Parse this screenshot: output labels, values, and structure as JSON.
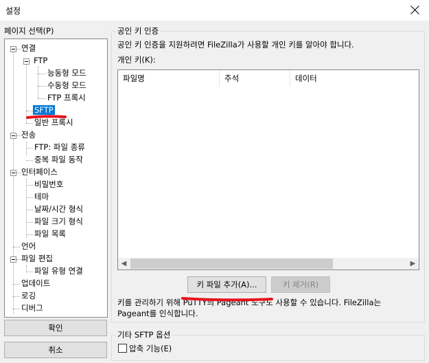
{
  "window": {
    "title": "설정"
  },
  "page_select_label": "페이지 선택(P)",
  "tree": [
    {
      "label": "연결"
    },
    {
      "label": "FTP"
    },
    {
      "label": "능동형 모드"
    },
    {
      "label": "수동형 모드"
    },
    {
      "label": "FTP 프록시"
    },
    {
      "label": "SFTP",
      "selected": true
    },
    {
      "label": "일반 프록시"
    },
    {
      "label": "전송"
    },
    {
      "label": "FTP: 파일 종류"
    },
    {
      "label": "중복 파일 동작"
    },
    {
      "label": "인터페이스"
    },
    {
      "label": "비밀번호"
    },
    {
      "label": "테마"
    },
    {
      "label": "날짜/시간 형식"
    },
    {
      "label": "파일 크기 형식"
    },
    {
      "label": "파일 목록"
    },
    {
      "label": "언어"
    },
    {
      "label": "파일 편집"
    },
    {
      "label": "파일 유형 연결"
    },
    {
      "label": "업데이트"
    },
    {
      "label": "로깅"
    },
    {
      "label": "디버그"
    }
  ],
  "buttons": {
    "ok": "확인",
    "cancel": "취소",
    "add_key": "키 파일 추가(A)...",
    "remove_key": "키 제거(R)"
  },
  "pubkey_group": {
    "title": "공인 키 인증",
    "description": "공인 키 인증을 지원하려면 FileZilla가 사용할 개인 키를 알아야 합니다.",
    "private_keys_label": "개인 키(K):",
    "columns": [
      "파일명",
      "주석",
      "데이터"
    ],
    "footer_line1": "키를 관리하기 위해 PuTTY의 Pageant 도구도 사용할 수 있습니다. FileZilla는",
    "footer_line2": "Pageant를 인식합니다."
  },
  "other_group": {
    "title": "기타 SFTP 옵션",
    "compression_label": "압축 기능(E)",
    "compression_checked": false
  },
  "annotation_color": "#e8141e",
  "selection_color": "#0078d7"
}
